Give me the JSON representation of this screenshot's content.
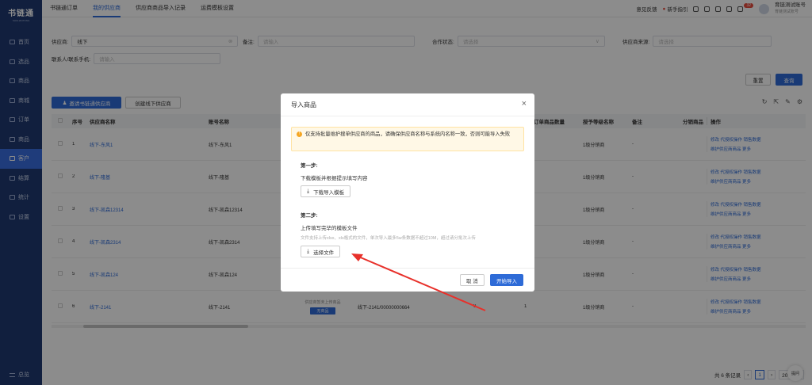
{
  "app": {
    "name": "书链通",
    "sub": "SHULIANTONG"
  },
  "sidebar": {
    "items": [
      {
        "label": "首页",
        "active": false
      },
      {
        "label": "选品",
        "active": false
      },
      {
        "label": "商品",
        "active": false
      },
      {
        "label": "商城",
        "active": false
      },
      {
        "label": "订单",
        "active": false
      },
      {
        "label": "商品",
        "active": false
      },
      {
        "label": "客户",
        "active": true
      },
      {
        "label": "结算",
        "active": false
      },
      {
        "label": "统计",
        "active": false
      },
      {
        "label": "设置",
        "active": false
      }
    ],
    "collapse_label": "总览"
  },
  "topbar": {
    "tabs": [
      {
        "label": "书链通订单",
        "active": false
      },
      {
        "label": "我的供应商",
        "active": true
      },
      {
        "label": "供应商商品导入记录",
        "active": false
      },
      {
        "label": "运费模板设置",
        "active": false
      }
    ],
    "feedback": "意见反馈",
    "guide": "新手指引",
    "badge": "32",
    "user_name": "育链测试账号",
    "user_role": "育链测试账号"
  },
  "filters": {
    "supplier_label": "供应商:",
    "supplier_value": "线下",
    "remark_label": "备注:",
    "remark_placeholder": "请输入",
    "coop_label": "合作状态:",
    "coop_placeholder": "请选择",
    "source_label": "供应商来源:",
    "source_placeholder": "请选择",
    "contact_label": "联系人/联系手机:",
    "contact_placeholder": "请输入",
    "reset": "重置",
    "search": "查询"
  },
  "actions": {
    "invite": "邀请书链通供应商",
    "create": "创建线下供应商"
  },
  "table": {
    "headers": [
      "序号",
      "供应商名称",
      "账号名称",
      "订单商品数量",
      "授予等级名称",
      "备注",
      "分销商品",
      "操作"
    ],
    "rows": [
      {
        "no": "1",
        "name": "线下-东风1",
        "account": "线下-东风1",
        "level": "1级分销商",
        "remark": "-",
        "ops1": "修改  代授权操作  销售数据",
        "ops2": "维护供应商商品  更多"
      },
      {
        "no": "2",
        "name": "线下-隆基",
        "account": "线下-隆基",
        "level": "1级分销商",
        "remark": "-",
        "ops1": "修改  代授权操作  销售数据",
        "ops2": "维护供应商商品  更多"
      },
      {
        "no": "3",
        "name": "线下-凯森12314",
        "account": "线下-凯森12314",
        "level": "1级分销商",
        "remark": "-",
        "ops1": "修改  代授权操作  销售数据",
        "ops2": "维护供应商商品  更多"
      },
      {
        "no": "4",
        "name": "线下-凯森2314",
        "account": "线下-凯森2314",
        "level": "1级分销商",
        "remark": "-",
        "ops1": "修改  代授权操作  销售数据",
        "ops2": "维护供应商商品  更多"
      },
      {
        "no": "5",
        "name": "线下-凯森124",
        "account": "线下-凯森124",
        "level": "1级分销商",
        "remark": "-",
        "ops1": "修改  代授权操作  销售数据",
        "ops2": "维护供应商商品  更多"
      },
      {
        "no": "6",
        "name": "线下-2141",
        "account": "线下-2141",
        "level": "1级分销商",
        "remark": "-",
        "ops1": "修改  代授权操作  销售数据",
        "ops2": "维护供应商商品  更多",
        "extra_text": "供应商暂未上传商品",
        "extra_tag": "无商品",
        "extra_id": "线下-2141/00000000664",
        "extra_count": "0",
        "extra_num": "1"
      }
    ]
  },
  "pagination": {
    "total": "共 6 条记录",
    "page": "1",
    "size": "20 条/页"
  },
  "help_label": "提问",
  "modal": {
    "title": "导入商品",
    "warning": "仅支持批量维护搜单供应商的商品，请确保供应商名称与系统内名称一致，否则可能导入失败",
    "step1_title": "第一步:",
    "step1_desc": "下载模板并根据提示填写内容",
    "download_btn": "下载导入模板",
    "step2_title": "第二步:",
    "step2_desc": "上传填写完毕的模板文件",
    "step2_hint": "文件支持上传xlsx、xls格式的文件，单次导入最多5w条数据不超过10M，超过请分批次上传",
    "choose_btn": "选择文件",
    "cancel": "取 消",
    "start": "开始导入"
  }
}
